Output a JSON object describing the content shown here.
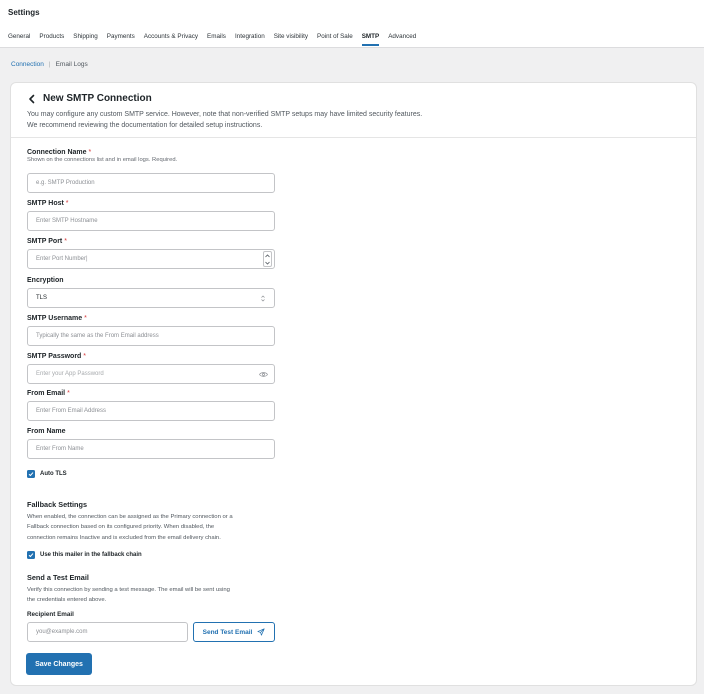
{
  "header": {
    "title": "Settings",
    "tabs": [
      "General",
      "Products",
      "Shipping",
      "Payments",
      "Accounts & Privacy",
      "Emails",
      "Integration",
      "Site visibility",
      "Point of Sale",
      "SMTP",
      "Advanced"
    ],
    "active_tab": "SMTP"
  },
  "subnav": {
    "connection": "Connection",
    "separator": "|",
    "email_logs": "Email Logs"
  },
  "form": {
    "title": "New SMTP Connection",
    "description_1": "You may configure any custom SMTP service. However, note that non-verified SMTP setups may have limited security features.",
    "description_2": "We recommend reviewing the documentation for detailed setup instructions.",
    "required_mark": "*",
    "connection_name": {
      "label": "Connection Name",
      "help": "Shown on the connections list and in email logs. Required.",
      "placeholder": "e.g. SMTP Production"
    },
    "smtp_host": {
      "label": "SMTP Host",
      "placeholder": "Enter SMTP Hostname"
    },
    "smtp_port": {
      "label": "SMTP Port",
      "placeholder": "Enter Port Number|"
    },
    "encryption": {
      "label": "Encryption",
      "value": "TLS"
    },
    "smtp_username": {
      "label": "SMTP Username",
      "placeholder": "Typically the same as the From Email address"
    },
    "smtp_password": {
      "label": "SMTP Password",
      "placeholder": "Enter your App Password"
    },
    "from_email": {
      "label": "From Email",
      "placeholder": "Enter From Email Address"
    },
    "from_name": {
      "label": "From Name",
      "placeholder": "Enter From Name"
    },
    "auto_tls": {
      "label": "Auto TLS",
      "checked": true
    },
    "fallback": {
      "title": "Fallback Settings",
      "line_1": "When enabled, the connection can be assigned as the Primary connection or a",
      "line_2": "Fallback connection based on its configured priority. When disabled, the",
      "line_3": "connection remains Inactive and is excluded from the email delivery chain.",
      "checkbox_label": "Use this mailer in the fallback chain",
      "checked": true
    },
    "test_email": {
      "title": "Send a Test Email",
      "line_1": "Verify this connection by sending a test message. The email will be sent using",
      "line_2": "the credentials entered above.",
      "recipient_label": "Recipient Email",
      "recipient_placeholder": "you@example.com",
      "send_button": "Send Test Email"
    },
    "save_button": "Save Changes"
  },
  "colors": {
    "accent": "#2271b1",
    "required": "#d63638",
    "background": "#f0f0f1"
  }
}
